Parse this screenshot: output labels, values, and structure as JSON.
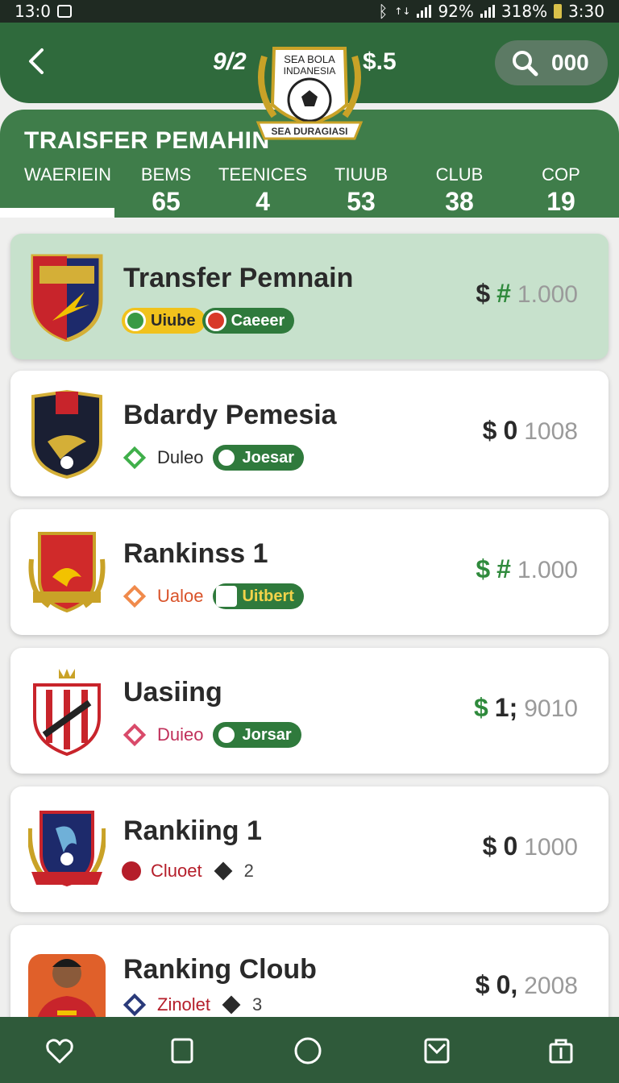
{
  "status": {
    "time": "13:0",
    "network": "ᛒ",
    "signal_text": "↑↓",
    "battery1": "92%",
    "battery2": "318%",
    "clock_right": "3:30"
  },
  "header": {
    "back_icon": "chevron-left-icon",
    "left_value": "9/2",
    "right_value": "$.5",
    "search_value": "000",
    "logo_top": "SEA BOLA",
    "logo_mid": "INDANESIA",
    "logo_banner": "SEA DURAGIASI"
  },
  "panel": {
    "title": "TRAISFER PEMAHIN",
    "stats": [
      {
        "label": "WAERIEIN",
        "value": ""
      },
      {
        "label": "BEMS",
        "value": "65"
      },
      {
        "label": "TEENICES",
        "value": "4"
      },
      {
        "label": "TIUUB",
        "value": "53"
      },
      {
        "label": "CLUB",
        "value": "38"
      },
      {
        "label": "COP",
        "value": "19"
      }
    ]
  },
  "list": [
    {
      "name": "Transfer Pemnain",
      "tag1": "Uiube",
      "tag2": "Caeeer",
      "currency": "$",
      "price_prefix": "#",
      "price": "1.000",
      "highlight": true
    },
    {
      "name": "Bdardy Pemesia",
      "tag1": "Duleo",
      "tag2": "Joesar",
      "currency": "$",
      "price_prefix": "0",
      "price": "1008"
    },
    {
      "name": "Rankinss 1",
      "tag1": "Ualoe",
      "tag2": "Uitbert",
      "currency": "$",
      "price_prefix": "#",
      "price": "1.000"
    },
    {
      "name": "Uasiing",
      "tag1": "Duieo",
      "tag2": "Jorsar",
      "currency": "$",
      "price_prefix": "1;",
      "price": "9010"
    },
    {
      "name": "Rankiing 1",
      "tag1": "Cluoet",
      "tag2": "2",
      "currency": "$",
      "price_prefix": "0",
      "price": "1000"
    },
    {
      "name": "Ranking Cloub",
      "tag1": "Zinolet",
      "tag2": "3",
      "currency": "$",
      "price_prefix": "0,",
      "price": "2008"
    }
  ],
  "colors": {
    "brand_green": "#2f6a3c",
    "panel_green": "#3f7d4a",
    "highlight": "#c7e1cc",
    "nav_bg": "#2f5a3a",
    "accent_green": "#2f8a3c"
  },
  "nav": [
    "heart-icon",
    "square-icon",
    "circle-icon",
    "mail-icon",
    "bag-icon"
  ]
}
